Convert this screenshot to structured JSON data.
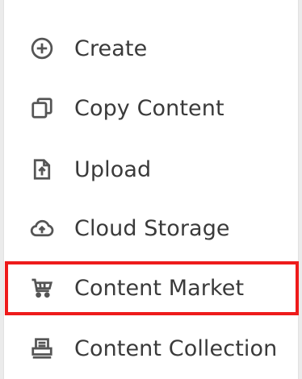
{
  "menu": {
    "items": [
      {
        "label": "Create",
        "icon": "plus-circle-icon"
      },
      {
        "label": "Copy Content",
        "icon": "copy-icon"
      },
      {
        "label": "Upload",
        "icon": "upload-file-icon"
      },
      {
        "label": "Cloud Storage",
        "icon": "cloud-upload-icon"
      },
      {
        "label": "Content Market",
        "icon": "shopping-cart-icon"
      },
      {
        "label": "Content Collection",
        "icon": "printer-icon"
      }
    ],
    "highlighted_item": "Content Market"
  },
  "colors": {
    "highlight_border": "#ee1b1b",
    "icon": "#555555",
    "text": "#3a3a3a"
  }
}
